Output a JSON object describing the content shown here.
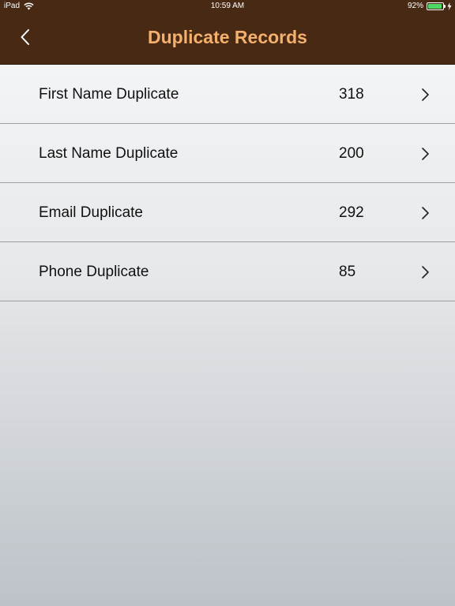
{
  "status_bar": {
    "device": "iPad",
    "time": "10:59 AM",
    "battery_percent": "92%",
    "battery_level": 0.92,
    "battery_color": "#4cd964"
  },
  "nav": {
    "title": "Duplicate Records",
    "back_icon": "chevron-left-icon",
    "background_color": "#482a14",
    "title_color": "#f4b06c"
  },
  "rows": [
    {
      "label": "First Name Duplicate",
      "count": "318"
    },
    {
      "label": "Last Name Duplicate",
      "count": "200"
    },
    {
      "label": "Email Duplicate",
      "count": "292"
    },
    {
      "label": "Phone Duplicate",
      "count": "85"
    }
  ]
}
